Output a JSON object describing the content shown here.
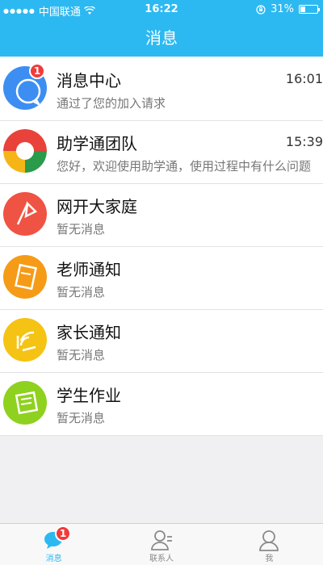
{
  "status_bar": {
    "carrier": "中国联通",
    "time": "16:22",
    "battery": "31%",
    "battery_level": 0.31
  },
  "nav": {
    "title": "消息"
  },
  "conversations": [
    {
      "title": "消息中心",
      "subtitle": "通过了您的加入请求",
      "time": "16:01",
      "badge": "1",
      "avatar_color": "#3d8ef2",
      "icon": "chat-bubble-icon"
    },
    {
      "title": "助学通团队",
      "subtitle": "您好，欢迎使用助学通，使用过程中有什么问题",
      "time": "15:39",
      "avatar_color": "#e8423a",
      "icon": "team-logo-icon"
    },
    {
      "title": "网开大家庭",
      "subtitle": "暂无消息",
      "avatar_color": "#ef5343",
      "icon": "flag-icon"
    },
    {
      "title": "老师通知",
      "subtitle": "暂无消息",
      "avatar_color": "#f59b17",
      "icon": "notebook-icon"
    },
    {
      "title": "家长通知",
      "subtitle": "暂无消息",
      "avatar_color": "#f5c313",
      "icon": "broadcast-icon"
    },
    {
      "title": "学生作业",
      "subtitle": "暂无消息",
      "avatar_color": "#8fd11f",
      "icon": "homework-icon"
    }
  ],
  "tabs": [
    {
      "label": "消息",
      "icon": "message-icon",
      "badge": "1",
      "active": true
    },
    {
      "label": "联系人",
      "icon": "contacts-icon"
    },
    {
      "label": "我",
      "icon": "profile-icon"
    }
  ],
  "colors": {
    "accent": "#2cb9f2",
    "badge": "#f23a3a"
  }
}
